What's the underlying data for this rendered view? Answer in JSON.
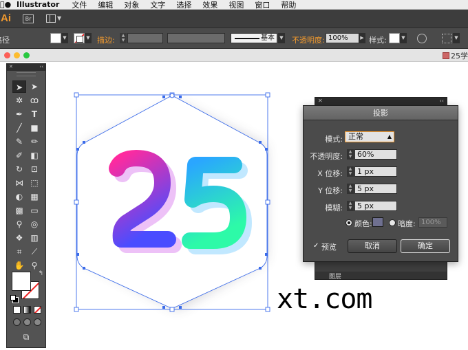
{
  "menubar": {
    "app_name": "Illustrator",
    "items": [
      "文件",
      "编辑",
      "对象",
      "文字",
      "选择",
      "效果",
      "视图",
      "窗口",
      "帮助"
    ]
  },
  "appbar": {
    "logo": "Ai",
    "bridge": "Br"
  },
  "control_bar": {
    "path_label": "路径",
    "stroke_label": "描边:",
    "stroke_style": "基本",
    "opacity_label": "不透明度:",
    "opacity_value": "100%",
    "style_label": "样式:"
  },
  "document": {
    "tab_title": "25学"
  },
  "artwork": {
    "number_text": "25",
    "caption": "xt.com",
    "colors": {
      "two_top": "#ff2a9e",
      "two_bottom": "#4a4dff",
      "five_top": "#2aa6ff",
      "five_bottom": "#2dfaa8",
      "selection": "#2f62e6"
    }
  },
  "tools": {
    "icons": [
      "selection-icon",
      "direct-selection-icon",
      "magic-wand-icon",
      "lasso-icon",
      "pen-icon",
      "type-icon",
      "line-icon",
      "rectangle-icon",
      "paintbrush-icon",
      "pencil-icon",
      "blob-brush-icon",
      "eraser-icon",
      "rotate-icon",
      "scale-icon",
      "width-icon",
      "free-transform-icon",
      "shape-builder-icon",
      "perspective-icon",
      "mesh-icon",
      "gradient-icon",
      "eyedropper-icon",
      "blend-icon",
      "symbol-sprayer-icon",
      "graph-icon",
      "artboard-icon",
      "slice-icon",
      "hand-icon",
      "zoom-icon"
    ]
  },
  "layers_panel": {
    "label": "图层"
  },
  "drop_shadow_dialog": {
    "title": "投影",
    "mode_label": "模式:",
    "mode_value": "正常",
    "opacity_label": "不透明度:",
    "opacity_value": "60%",
    "x_offset_label": "X 位移:",
    "x_offset_value": "1 px",
    "y_offset_label": "Y 位移:",
    "y_offset_value": "5 px",
    "blur_label": "模糊:",
    "blur_value": "5 px",
    "color_label": "颜色:",
    "darkness_label": "暗度:",
    "darkness_value": "100%",
    "preview_label": "预览",
    "preview_checked": true,
    "cancel_label": "取消",
    "ok_label": "确定"
  }
}
